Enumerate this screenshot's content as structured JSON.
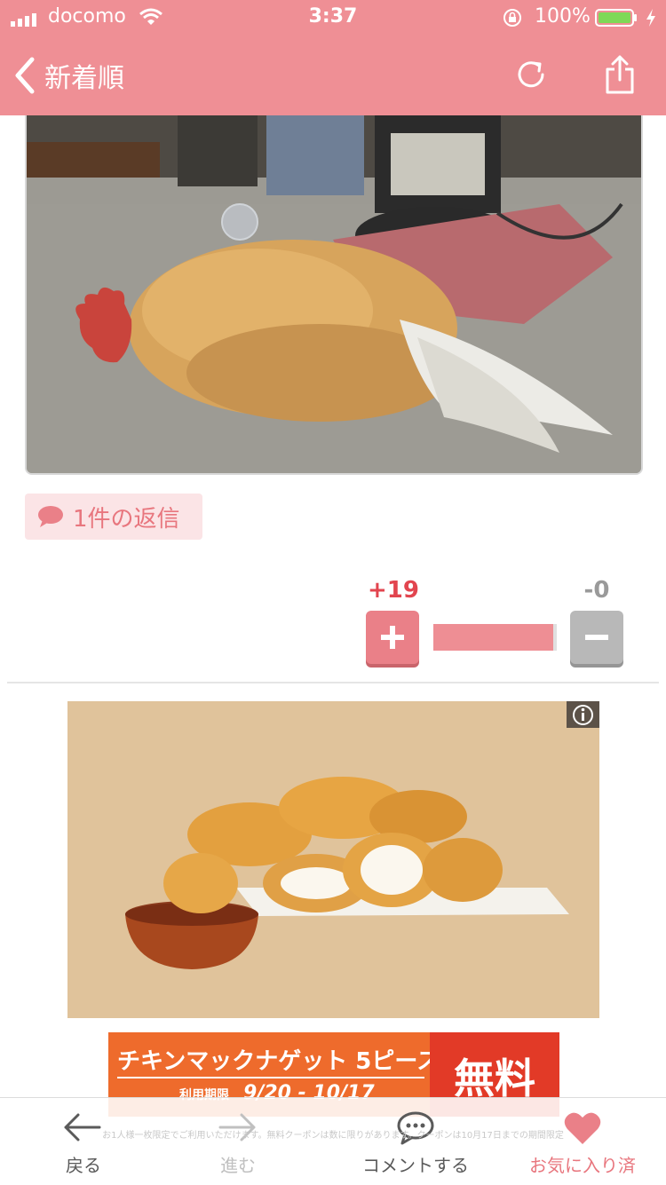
{
  "status_bar": {
    "carrier": "docomo",
    "time": "3:37",
    "battery_percent": "100%"
  },
  "nav": {
    "back_label": "新着順"
  },
  "post": {
    "reply_label": "1件の返信"
  },
  "votes": {
    "plus_count": "+19",
    "minus_count": "-0",
    "plus_ratio": 0.97
  },
  "ad": {
    "headline": "チキンマックナゲット 5ピース",
    "period_label": "利用期限",
    "period": "9/20 - 10/17",
    "free_label": "無料",
    "disclaimer": "お1人様一枚限定でご利用いただけます。無料クーポンは数に限りがあります。クーポンは10月17日までの期間限定"
  },
  "tab_bar": {
    "back": "戻る",
    "forward": "進む",
    "comment": "コメントする",
    "favorite": "お気に入り済"
  },
  "colors": {
    "accent": "#ef8f95",
    "plus": "#e2454f",
    "reply_bg": "#fbe4e6"
  }
}
